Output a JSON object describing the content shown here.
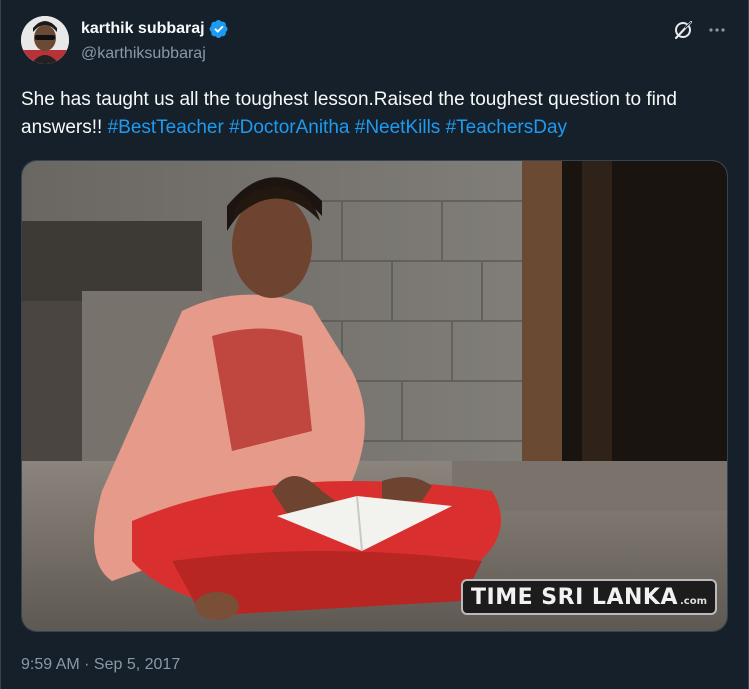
{
  "author": {
    "name": "karthik subbaraj",
    "handle": "@karthiksubbaraj",
    "verified": true
  },
  "tweet": {
    "text": "She has taught us all the toughest lesson.Raised the toughest question to find answers!! ",
    "hashtags": [
      "#BestTeacher",
      "#DoctorAnitha",
      "#NeetKills",
      "#TeachersDay"
    ]
  },
  "media": {
    "watermark_main": "TIME SRI LANKA",
    "watermark_suffix": ".com"
  },
  "meta": {
    "timestamp": "9:59 AM · Sep 5, 2017"
  },
  "colors": {
    "background": "#15202b",
    "link": "#1d9bf0",
    "secondary_text": "#8b98a5",
    "verified_badge": "#1d9bf0"
  },
  "icons": [
    "verified-badge-icon",
    "grok-icon",
    "more-icon"
  ]
}
